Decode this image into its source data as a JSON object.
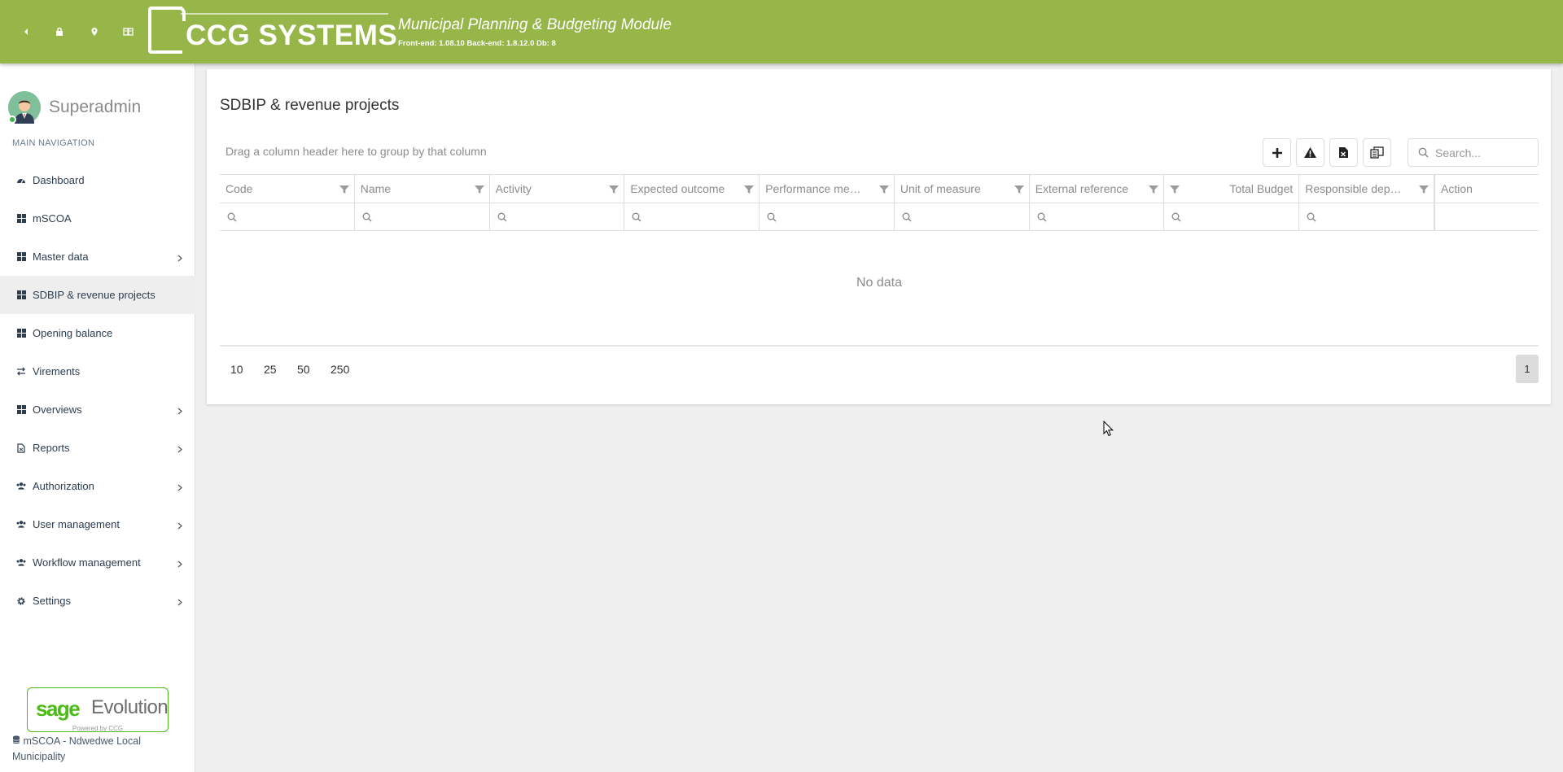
{
  "header": {
    "logo_text": "CCG SYSTEMS",
    "app_title": "Municipal Planning & Budgeting Module",
    "version": "Front-end: 1.08.10 Back-end: 1.8.12.0 Db: 8",
    "color": "#97b64a"
  },
  "sidebar": {
    "user_name": "Superadmin",
    "nav_header": "MAIN NAVIGATION",
    "items": [
      {
        "label": "Dashboard",
        "icon": "dashboard-icon"
      },
      {
        "label": "mSCOA",
        "icon": "grid-icon"
      },
      {
        "label": "Master data",
        "icon": "grid-icon",
        "has_children": true
      },
      {
        "label": "SDBIP & revenue projects",
        "icon": "grid-icon",
        "active": true
      },
      {
        "label": "Opening balance",
        "icon": "grid-icon"
      },
      {
        "label": "Virements",
        "icon": "exchange-icon"
      },
      {
        "label": "Overviews",
        "icon": "grid-icon",
        "has_children": true
      },
      {
        "label": "Reports",
        "icon": "file-icon",
        "has_children": true
      },
      {
        "label": "Authorization",
        "icon": "users-icon",
        "has_children": true
      },
      {
        "label": "User management",
        "icon": "users-icon",
        "has_children": true
      },
      {
        "label": "Workflow management",
        "icon": "users-icon",
        "has_children": true
      },
      {
        "label": "Settings",
        "icon": "gear-icon",
        "has_children": true
      }
    ],
    "sage_word": "sage",
    "sage_evolution": "Evolution",
    "sage_powered": "Powered by CCG",
    "db_info": "mSCOA - Ndwedwe Local Municipality"
  },
  "main": {
    "title": "SDBIP & revenue projects",
    "group_panel_text": "Drag a column header here to group by that column",
    "search_placeholder": "Search...",
    "columns": [
      "Code",
      "Name",
      "Activity",
      "Expected outcome",
      "Performance meas...",
      "Unit of measure",
      "External reference",
      "Total Budget",
      "Responsible depar...",
      "Action"
    ],
    "no_data": "No data",
    "page_sizes": [
      "10",
      "25",
      "50",
      "250"
    ],
    "current_page": "1"
  }
}
